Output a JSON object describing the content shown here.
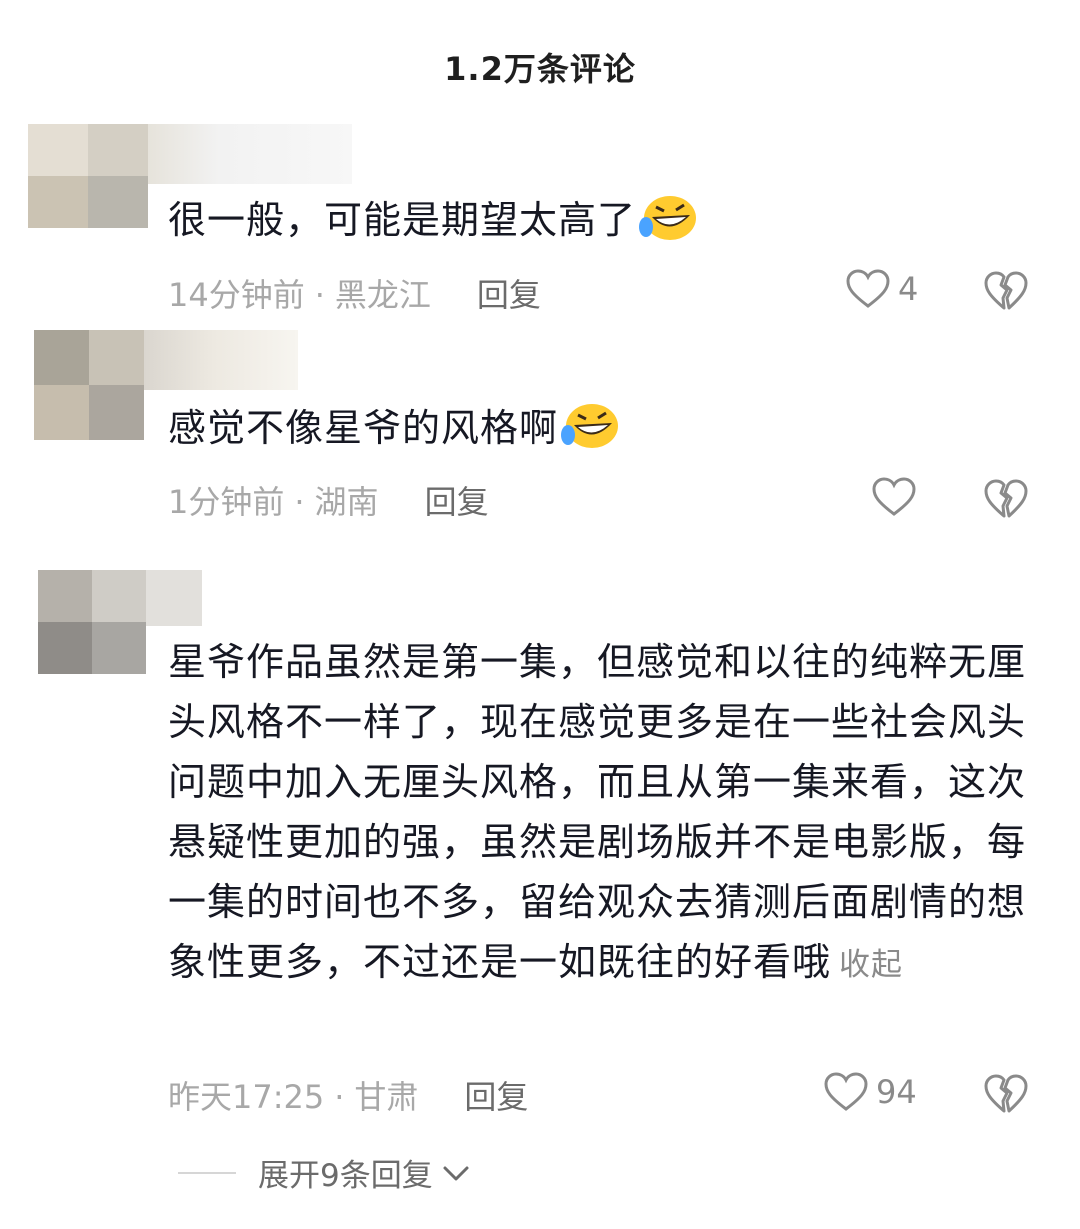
{
  "header": {
    "title": "1.2万条评论"
  },
  "comments": [
    {
      "text": "很一般，可能是期望太高了",
      "emoji": "laughing-crying-emoji",
      "time": "14分钟前",
      "location": "黑龙江",
      "reply_label": "回复",
      "like_count": "4"
    },
    {
      "text": "感觉不像星爷的风格啊",
      "emoji": "laughing-crying-emoji",
      "time": "1分钟前",
      "location": "湖南",
      "reply_label": "回复",
      "like_count": ""
    },
    {
      "text": "星爷作品虽然是第一集，但感觉和以往的纯粹无厘头风格不一样了，现在感觉更多是在一些社会风头问题中加入无厘头风格，而且从第一集来看，这次悬疑性更加的强，虽然是剧场版并不是电影版，每一集的时间也不多，留给观众去猜测后面剧情的想象性更多，不过还是一如既往的好看哦",
      "collapse_label": "收起",
      "time": "昨天17:25",
      "location": "甘肃",
      "reply_label": "回复",
      "like_count": "94",
      "expand_label": "展开9条回复"
    }
  ],
  "meta_separator": "·",
  "icons": {
    "like": "heart-icon",
    "dislike": "broken-heart-icon",
    "expand": "chevron-down-icon"
  }
}
